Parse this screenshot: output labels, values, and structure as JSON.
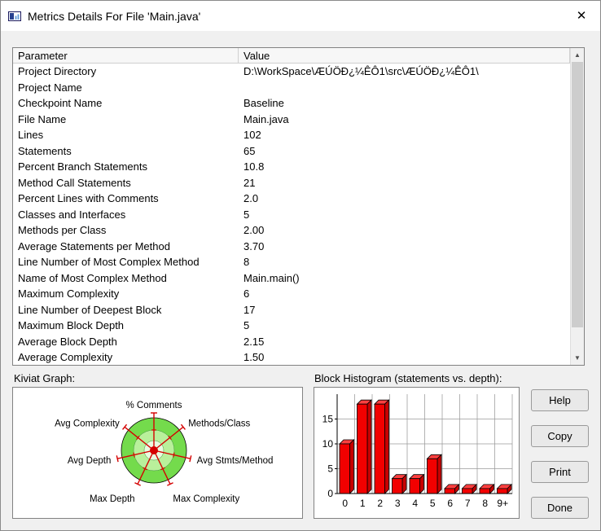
{
  "window": {
    "title": "Metrics Details For File 'Main.java'"
  },
  "icons": {
    "close": "✕",
    "scroll_up": "▲",
    "scroll_down": "▼"
  },
  "table": {
    "columns": [
      "Parameter",
      "Value"
    ],
    "rows": [
      {
        "parameter": "Project Directory",
        "value": "D:\\WorkSpace\\ÆÚÖÐ¿¼ÊÔ1\\src\\ÆÚÖÐ¿¼ÊÔ1\\"
      },
      {
        "parameter": "Project Name",
        "value": ""
      },
      {
        "parameter": "Checkpoint Name",
        "value": "Baseline"
      },
      {
        "parameter": "File Name",
        "value": "Main.java"
      },
      {
        "parameter": "Lines",
        "value": "102"
      },
      {
        "parameter": "Statements",
        "value": "65"
      },
      {
        "parameter": "Percent Branch Statements",
        "value": "10.8"
      },
      {
        "parameter": "Method Call Statements",
        "value": "21"
      },
      {
        "parameter": "Percent Lines with Comments",
        "value": "2.0"
      },
      {
        "parameter": "Classes and Interfaces",
        "value": "5"
      },
      {
        "parameter": "Methods per Class",
        "value": "2.00"
      },
      {
        "parameter": "Average Statements per Method",
        "value": "3.70"
      },
      {
        "parameter": "Line Number of Most Complex Method",
        "value": "8"
      },
      {
        "parameter": "Name of Most Complex Method",
        "value": "Main.main()"
      },
      {
        "parameter": "Maximum Complexity",
        "value": "6"
      },
      {
        "parameter": "Line Number of Deepest Block",
        "value": "17"
      },
      {
        "parameter": "Maximum Block Depth",
        "value": "5"
      },
      {
        "parameter": "Average Block Depth",
        "value": "2.15"
      },
      {
        "parameter": "Average Complexity",
        "value": "1.50"
      }
    ]
  },
  "kiviat": {
    "label": "Kiviat Graph:"
  },
  "histogram": {
    "label": "Block Histogram (statements vs. depth):"
  },
  "buttons": [
    "Help",
    "Copy",
    "Print",
    "Done"
  ],
  "chart_data": [
    {
      "type": "bar",
      "title": "Block Histogram (statements vs. depth):",
      "categories": [
        "0",
        "1",
        "2",
        "3",
        "4",
        "5",
        "6",
        "7",
        "8",
        "9+"
      ],
      "values": [
        10,
        18,
        18,
        3,
        3,
        7,
        1,
        1,
        1,
        1
      ],
      "xlabel": "",
      "ylabel": "",
      "ylim": [
        0,
        20
      ],
      "yticks": [
        0,
        5,
        10,
        15
      ],
      "style": {
        "front": "#f20000",
        "top": "#ff4040",
        "side": "#c80000",
        "grid": "#9a9a9a"
      }
    },
    {
      "type": "radar",
      "title": "Kiviat Graph:",
      "axes": [
        "% Comments",
        "Methods/Class",
        "Avg Stmts/Method",
        "Max Complexity",
        "Max Depth",
        "Avg Depth",
        "Avg Complexity"
      ],
      "style": {
        "outer": "#74db4c",
        "middle": "#b9f09b",
        "inner": "#e9fbe0",
        "spoke": "#d40000"
      }
    }
  ]
}
